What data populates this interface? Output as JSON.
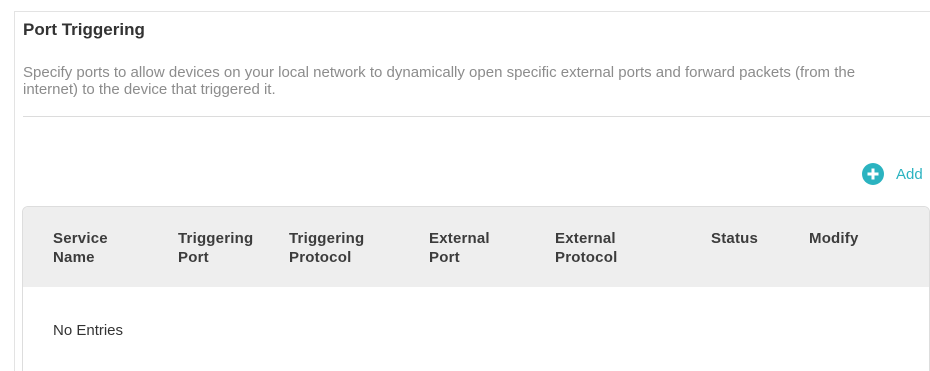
{
  "section": {
    "title": "Port Triggering",
    "description": "Specify ports to allow devices on your local network to dynamically open specific external ports and forward packets (from the internet) to the device that triggered it."
  },
  "toolbar": {
    "add_label": "Add",
    "add_icon": "plus-circle-icon",
    "accent_color": "#2bb3c0"
  },
  "table": {
    "columns": [
      {
        "line1": "Service",
        "line2": "Name"
      },
      {
        "line1": "Triggering",
        "line2": "Port"
      },
      {
        "line1": "Triggering",
        "line2": "Protocol"
      },
      {
        "line1": "External",
        "line2": "Port"
      },
      {
        "line1": "External",
        "line2": "Protocol"
      },
      {
        "line1": "Status",
        "line2": ""
      },
      {
        "line1": "Modify",
        "line2": ""
      }
    ],
    "empty_text": "No Entries",
    "header_bg": "#eeeeee"
  }
}
